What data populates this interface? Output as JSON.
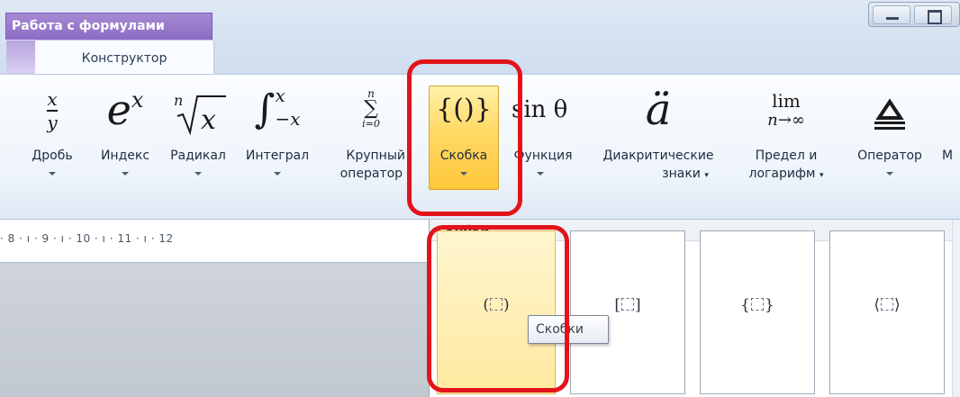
{
  "window": {
    "context_tab_header": "Работа с формулами",
    "active_tab": "Конструктор"
  },
  "ribbon": {
    "buttons": [
      {
        "id": "fraction",
        "label": "Дробь",
        "icon": "fraction-icon"
      },
      {
        "id": "index",
        "label": "Индекс",
        "icon": "script-icon"
      },
      {
        "id": "radical",
        "label": "Радикал",
        "icon": "radical-icon"
      },
      {
        "id": "integral",
        "label": "Интеграл",
        "icon": "integral-icon"
      },
      {
        "id": "large-operator",
        "label": "Крупный оператор",
        "label_line1": "Крупный",
        "label_line2": "оператор",
        "icon": "sum-icon"
      },
      {
        "id": "bracket",
        "label": "Скобка",
        "icon": "bracket-icon",
        "selected": true
      },
      {
        "id": "function",
        "label": "Функция",
        "icon": "function-icon"
      },
      {
        "id": "accent",
        "label": "Диакритические знаки",
        "label_line1": "Диакритические",
        "label_line2": "знаки",
        "icon": "accent-icon"
      },
      {
        "id": "limit",
        "label": "Предел и логарифм",
        "label_line1": "Предел и",
        "label_line2": "логарифм",
        "icon": "limit-icon"
      },
      {
        "id": "operator",
        "label": "Оператор",
        "icon": "operator-icon"
      },
      {
        "id": "matrix",
        "label": "М",
        "icon": "matrix-icon"
      }
    ],
    "icon_text": {
      "fraction_num": "x",
      "fraction_den": "y",
      "index_base": "e",
      "index_sup": "x",
      "radical_n": "n",
      "radical_x": "x",
      "integral_upper": "x",
      "integral_lower": "−x",
      "sum_upper": "n",
      "sum_lower": "i=0",
      "bracket": "{()}",
      "function": "sin θ",
      "accent": "ä",
      "limit_top": "lim",
      "limit_bottom": "n→∞"
    }
  },
  "ruler": {
    "ticks": "· 8 · ı · 9 · ı · 10 · ı · 11 · ı · 12"
  },
  "gallery": {
    "title": "Скобки",
    "items": [
      {
        "left": "(",
        "right": ")",
        "name": "parentheses"
      },
      {
        "left": "[",
        "right": "]",
        "name": "square-brackets"
      },
      {
        "left": "{",
        "right": "}",
        "name": "curly-braces"
      },
      {
        "left": "⟨",
        "right": "⟩",
        "name": "angle-brackets"
      }
    ]
  },
  "tooltip": "Скобки",
  "colors": {
    "selected": "#ffd865",
    "annotation_red": "#e3131b",
    "context_tab": "#8c6cc4"
  }
}
